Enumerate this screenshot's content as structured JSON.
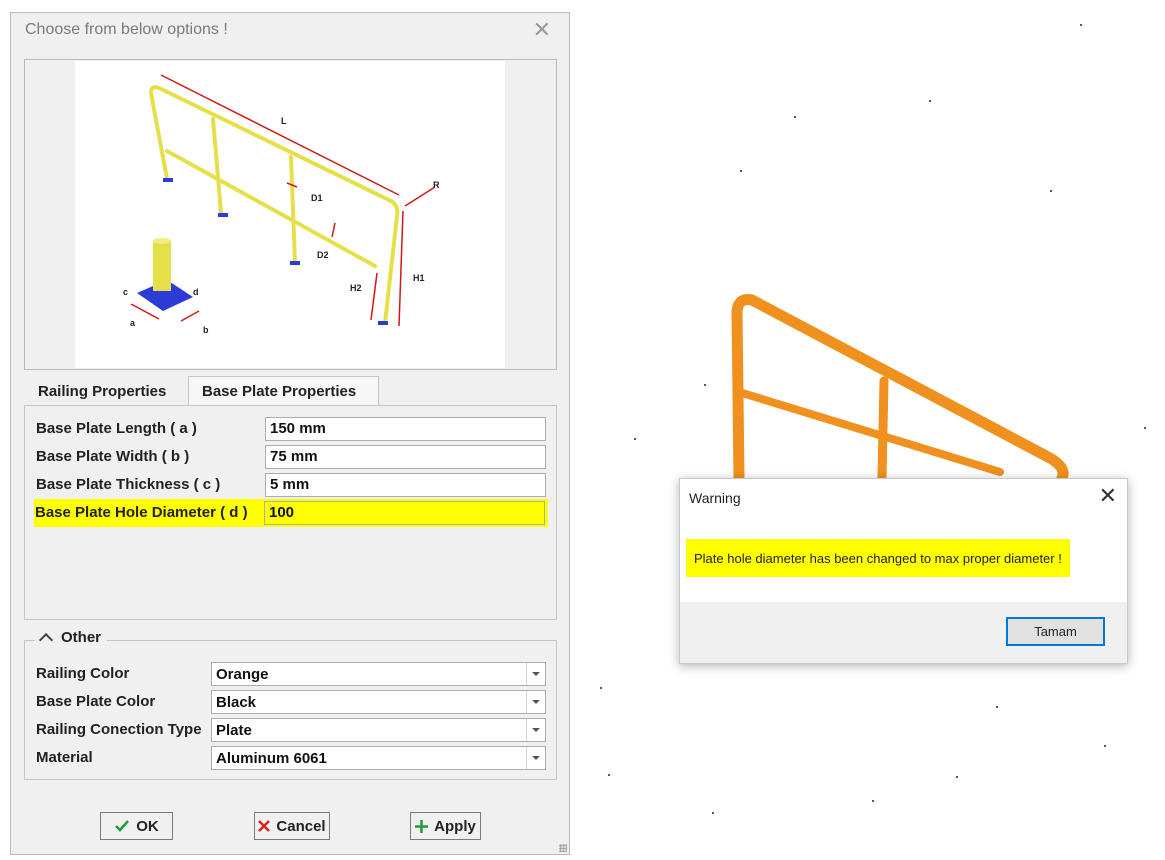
{
  "dialog": {
    "title": "Choose from below options !",
    "close_glyph": "✕",
    "diagram_labels": {
      "length": "L",
      "radius": "R",
      "d1": "D1",
      "d2": "D2",
      "h1": "H1",
      "h2": "H2",
      "a": "a",
      "b": "b",
      "c": "c",
      "d": "d"
    },
    "tabs": [
      {
        "label": "Railing Properties",
        "active": false
      },
      {
        "label": "Base Plate Properties",
        "active": true
      }
    ],
    "base_plate_properties": [
      {
        "label": "Base Plate Length ( a )",
        "value": "150 mm",
        "highlighted": false
      },
      {
        "label": "Base Plate Width ( b )",
        "value": "75 mm",
        "highlighted": false
      },
      {
        "label": "Base Plate Thickness ( c )",
        "value": "5 mm",
        "highlighted": false
      },
      {
        "label": "Base Plate Hole Diameter ( d )",
        "value": "100",
        "highlighted": true
      }
    ],
    "other_group": {
      "title": "Other",
      "fields": [
        {
          "label": "Railing Color",
          "value": "Orange"
        },
        {
          "label": "Base Plate Color",
          "value": "Black"
        },
        {
          "label": "Railing Conection Type",
          "value": "Plate"
        },
        {
          "label": "Material",
          "value": "Aluminum 6061"
        }
      ]
    },
    "buttons": {
      "ok": "OK",
      "cancel": "Cancel",
      "apply": "Apply"
    }
  },
  "warning": {
    "title": "Warning",
    "close_glyph": "✕",
    "message": "Plate hole diameter has been changed to max proper diameter !",
    "button": "Tamam"
  },
  "colors": {
    "highlight": "#ffff00",
    "railing_preview": "#e5e04a",
    "railing_model": "#f0901e",
    "base_plate_preview": "#2d3bd6",
    "dimension": "#d01818",
    "ok_check": "#1f9d3a",
    "cancel_x": "#d82020",
    "apply_plus": "#1f9d3a",
    "focus_border": "#0078d7"
  }
}
